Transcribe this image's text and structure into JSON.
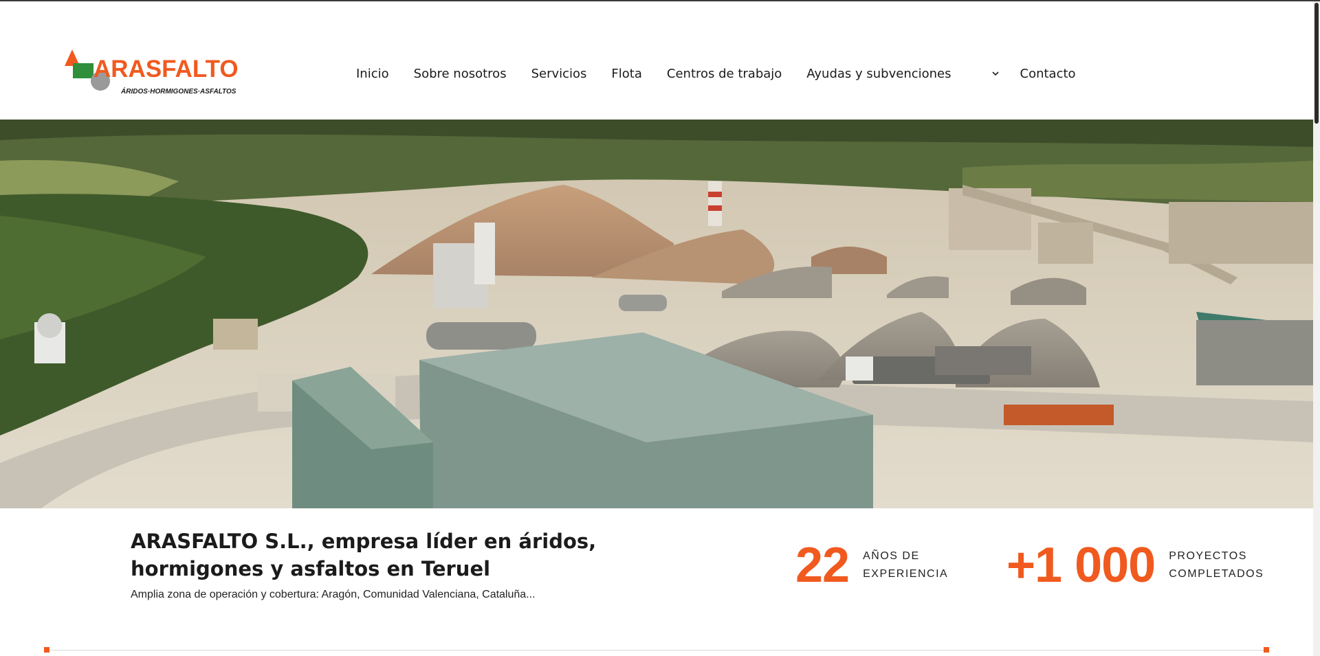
{
  "brand": {
    "name": "ARASFALTO",
    "tagline": "ÁRIDOS·HORMIGONES·ASFALTOS",
    "colors": {
      "accent": "#f05a1f",
      "green": "#2f8f3a",
      "grey": "#9a9a9a",
      "text": "#1b1b1b"
    }
  },
  "nav": {
    "items": [
      {
        "label": "Inicio"
      },
      {
        "label": "Sobre nosotros"
      },
      {
        "label": "Servicios"
      },
      {
        "label": "Flota"
      },
      {
        "label": "Centros de trabajo"
      },
      {
        "label": "Ayudas y subvenciones",
        "icon": "chevron-down-icon"
      },
      {
        "label": "Contacto"
      }
    ]
  },
  "hero": {
    "image": "aerial-view-of-quarry-and-asphalt-plant"
  },
  "intro": {
    "headline": "ARASFALTO S.L., empresa líder en áridos, hormigones y asfaltos en Teruel",
    "subline": "Amplia zona de operación y cobertura: Aragón, Comunidad Valenciana, Cataluña..."
  },
  "stats": [
    {
      "value": "22",
      "label_line1": "AÑOS DE",
      "label_line2": "EXPERIENCIA"
    },
    {
      "value": "+1 000",
      "label_line1": "PROYECTOS",
      "label_line2": "COMPLETADOS"
    }
  ]
}
